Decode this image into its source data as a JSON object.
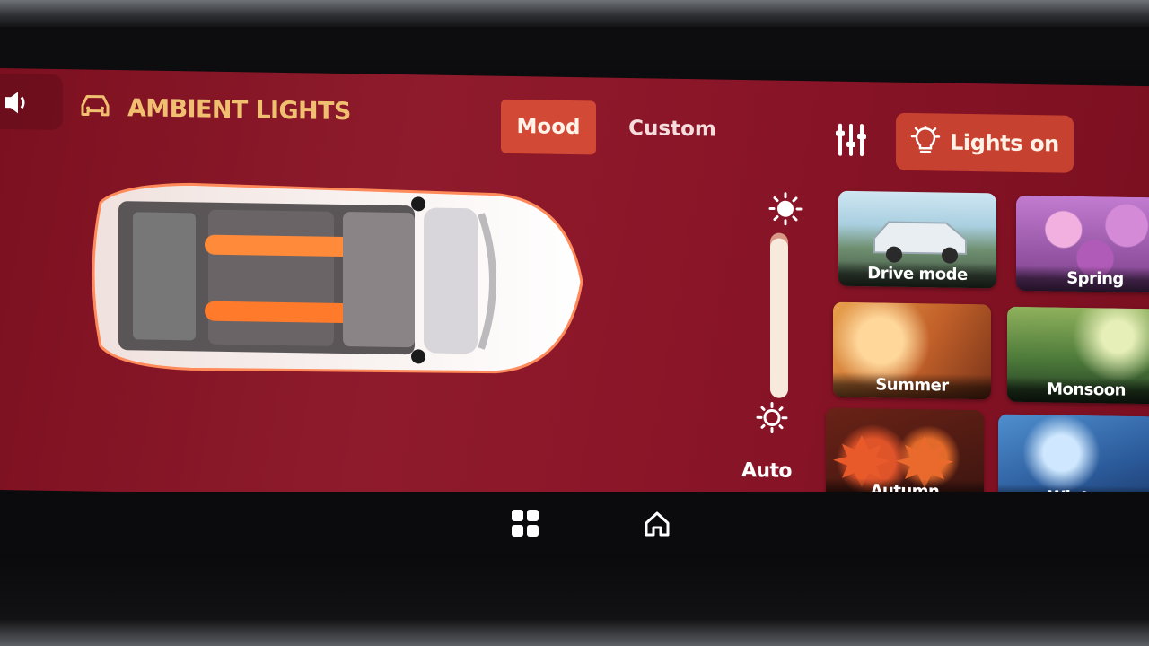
{
  "header": {
    "title": "AMBIENT LIGHTS",
    "title_icon": "car-front-icon",
    "back_icon": "back-icon"
  },
  "tabs": [
    {
      "label": "Mood",
      "active": true
    },
    {
      "label": "Custom",
      "active": false
    }
  ],
  "toolbar": {
    "settings_icon": "sliders-icon",
    "lights_label": "Lights on",
    "lights_icon": "bulb-icon"
  },
  "brightness": {
    "level": 0.97,
    "auto_label": "Auto"
  },
  "themes": [
    {
      "label": "Drive mode"
    },
    {
      "label": "Spring"
    },
    {
      "label": "Summer"
    },
    {
      "label": "Monsoon"
    },
    {
      "label": "Autumn"
    },
    {
      "label": "Winter"
    }
  ],
  "colors": {
    "panel": "#8a1528",
    "accent": "#d24935",
    "title": "#f0c070"
  }
}
